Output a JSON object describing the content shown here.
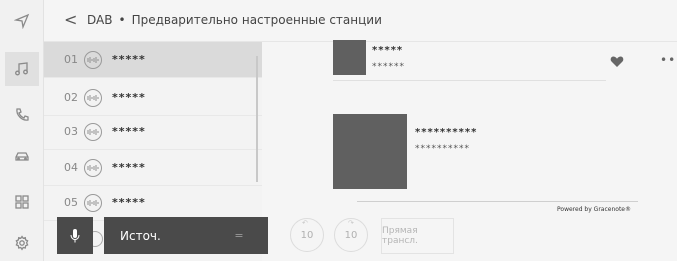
{
  "header": {
    "back_label": "<",
    "source": "DAB",
    "separator": "•",
    "title": "Предварительно настроенные станции"
  },
  "rail": {
    "items": [
      {
        "icon": "navigation-icon"
      },
      {
        "icon": "music-icon",
        "active": true
      },
      {
        "icon": "phone-icon"
      },
      {
        "icon": "car-icon"
      },
      {
        "icon": "apps-grid-icon"
      },
      {
        "icon": "settings-icon"
      }
    ]
  },
  "presets": [
    {
      "number": "01",
      "name": "*****",
      "active": true
    },
    {
      "number": "02",
      "name": "*****"
    },
    {
      "number": "03",
      "name": "*****"
    },
    {
      "number": "04",
      "name": "*****"
    },
    {
      "number": "05",
      "name": "*****"
    }
  ],
  "voice_bar": {
    "source_label": "Источ.",
    "source_icon": "="
  },
  "now_playing": {
    "station_title": "*****",
    "station_subtitle": "******",
    "track_title": "**********",
    "track_subtitle": "**********",
    "powered_by": "Powered by Gracenote®"
  },
  "controls": {
    "seek_back_label": "10",
    "seek_forward_label": "10",
    "direct_tune_label": "Прямая трансл."
  }
}
